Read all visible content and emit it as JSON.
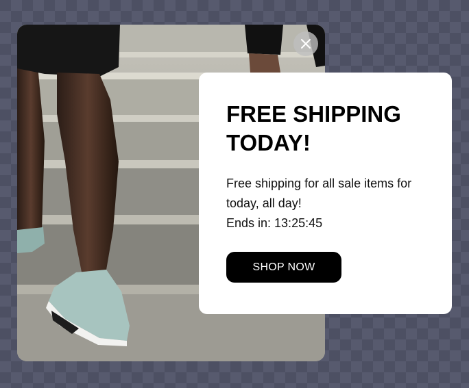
{
  "popup": {
    "headline": "FREE SHIPPING TODAY!",
    "body_line1": "Free shipping for all sale items for today, all day!",
    "countdown": "Ends in: 13:25:45",
    "cta_label": "SHOP NOW",
    "image": "runner-legs-on-stone-stairs",
    "close_icon": "close-icon"
  },
  "colors": {
    "backdrop": "#4d5063",
    "card": "#ffffff",
    "button": "#000000",
    "button_text": "#ffffff"
  }
}
